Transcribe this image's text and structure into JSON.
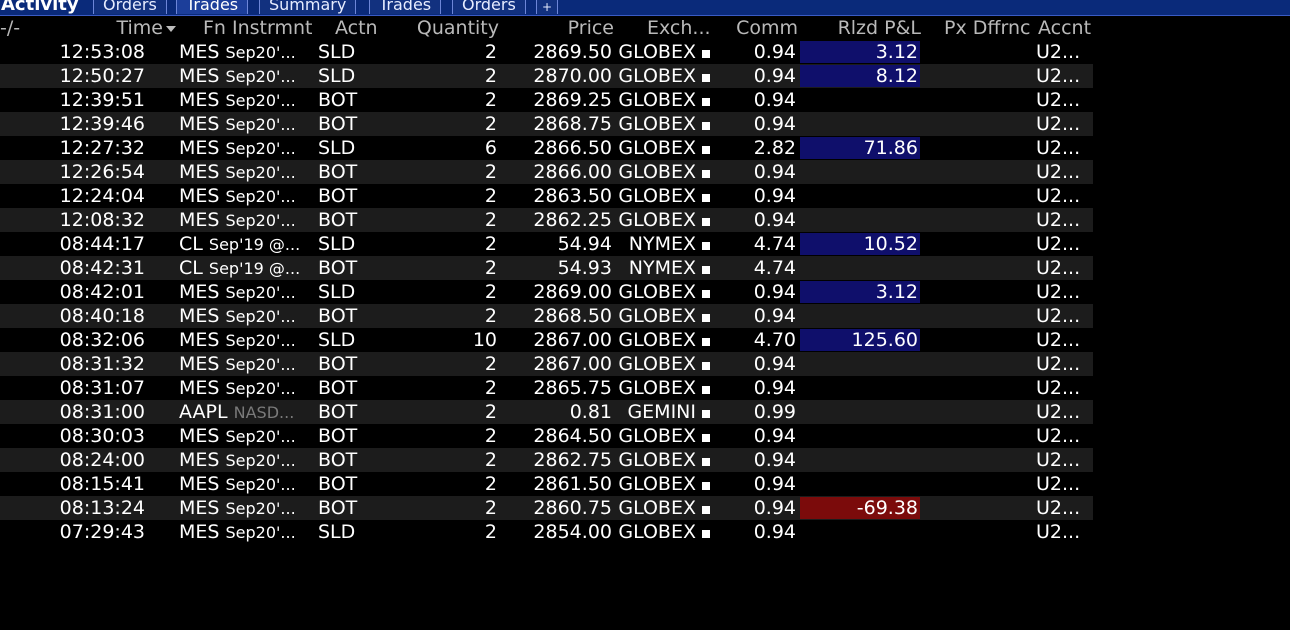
{
  "window": {
    "title": "Activity",
    "tabs": [
      {
        "label": "Orders",
        "active": false
      },
      {
        "label": "Trades",
        "active": true
      },
      {
        "label": "Summary",
        "active": false
      },
      {
        "label": "Trades",
        "active": false
      },
      {
        "label": "Orders",
        "active": false
      }
    ],
    "add_tab": "+"
  },
  "table": {
    "columns": {
      "filter": "-/-",
      "time": "Time",
      "instrument": "Fn Instrmnt",
      "action": "Actn",
      "quantity": "Quantity",
      "price": "Price",
      "exchange": "Exch...",
      "comm": "Comm",
      "pnl": "Rlzd P&L",
      "pxdiff": "Px Dffrnc",
      "account": "Accnt"
    },
    "sort_icon": "sort-descending-icon",
    "colors": {
      "pnl_positive_bg": "#0f0f6b",
      "pnl_negative_bg": "#7b0b0b",
      "row_alt_bg": "#1c1c1c"
    },
    "rows": [
      {
        "time": "12:53:08",
        "sym": "MES",
        "exp": "Sep20'...",
        "action": "SLD",
        "qty": "2",
        "price": "2869.50",
        "exch": "GLOBEX",
        "comm": "0.94",
        "pnl": "3.12",
        "pnl_sign": "pos",
        "acct": "U2..."
      },
      {
        "time": "12:50:27",
        "sym": "MES",
        "exp": "Sep20'...",
        "action": "SLD",
        "qty": "2",
        "price": "2870.00",
        "exch": "GLOBEX",
        "comm": "0.94",
        "pnl": "8.12",
        "pnl_sign": "pos",
        "acct": "U2..."
      },
      {
        "time": "12:39:51",
        "sym": "MES",
        "exp": "Sep20'...",
        "action": "BOT",
        "qty": "2",
        "price": "2869.25",
        "exch": "GLOBEX",
        "comm": "0.94",
        "pnl": "",
        "pnl_sign": "",
        "acct": "U2..."
      },
      {
        "time": "12:39:46",
        "sym": "MES",
        "exp": "Sep20'...",
        "action": "BOT",
        "qty": "2",
        "price": "2868.75",
        "exch": "GLOBEX",
        "comm": "0.94",
        "pnl": "",
        "pnl_sign": "",
        "acct": "U2..."
      },
      {
        "time": "12:27:32",
        "sym": "MES",
        "exp": "Sep20'...",
        "action": "SLD",
        "qty": "6",
        "price": "2866.50",
        "exch": "GLOBEX",
        "comm": "2.82",
        "pnl": "71.86",
        "pnl_sign": "pos",
        "acct": "U2..."
      },
      {
        "time": "12:26:54",
        "sym": "MES",
        "exp": "Sep20'...",
        "action": "BOT",
        "qty": "2",
        "price": "2866.00",
        "exch": "GLOBEX",
        "comm": "0.94",
        "pnl": "",
        "pnl_sign": "",
        "acct": "U2..."
      },
      {
        "time": "12:24:04",
        "sym": "MES",
        "exp": "Sep20'...",
        "action": "BOT",
        "qty": "2",
        "price": "2863.50",
        "exch": "GLOBEX",
        "comm": "0.94",
        "pnl": "",
        "pnl_sign": "",
        "acct": "U2..."
      },
      {
        "time": "12:08:32",
        "sym": "MES",
        "exp": "Sep20'...",
        "action": "BOT",
        "qty": "2",
        "price": "2862.25",
        "exch": "GLOBEX",
        "comm": "0.94",
        "pnl": "",
        "pnl_sign": "",
        "acct": "U2..."
      },
      {
        "time": "08:44:17",
        "sym": "CL",
        "exp": "Sep'19 @...",
        "action": "SLD",
        "qty": "2",
        "price": "54.94",
        "exch": "NYMEX",
        "comm": "4.74",
        "pnl": "10.52",
        "pnl_sign": "pos",
        "acct": "U2..."
      },
      {
        "time": "08:42:31",
        "sym": "CL",
        "exp": "Sep'19 @...",
        "action": "BOT",
        "qty": "2",
        "price": "54.93",
        "exch": "NYMEX",
        "comm": "4.74",
        "pnl": "",
        "pnl_sign": "",
        "acct": "U2..."
      },
      {
        "time": "08:42:01",
        "sym": "MES",
        "exp": "Sep20'...",
        "action": "SLD",
        "qty": "2",
        "price": "2869.00",
        "exch": "GLOBEX",
        "comm": "0.94",
        "pnl": "3.12",
        "pnl_sign": "pos",
        "acct": "U2..."
      },
      {
        "time": "08:40:18",
        "sym": "MES",
        "exp": "Sep20'...",
        "action": "BOT",
        "qty": "2",
        "price": "2868.50",
        "exch": "GLOBEX",
        "comm": "0.94",
        "pnl": "",
        "pnl_sign": "",
        "acct": "U2..."
      },
      {
        "time": "08:32:06",
        "sym": "MES",
        "exp": "Sep20'...",
        "action": "SLD",
        "qty": "10",
        "price": "2867.00",
        "exch": "GLOBEX",
        "comm": "4.70",
        "pnl": "125.60",
        "pnl_sign": "pos",
        "acct": "U2..."
      },
      {
        "time": "08:31:32",
        "sym": "MES",
        "exp": "Sep20'...",
        "action": "BOT",
        "qty": "2",
        "price": "2867.00",
        "exch": "GLOBEX",
        "comm": "0.94",
        "pnl": "",
        "pnl_sign": "",
        "acct": "U2..."
      },
      {
        "time": "08:31:07",
        "sym": "MES",
        "exp": "Sep20'...",
        "action": "BOT",
        "qty": "2",
        "price": "2865.75",
        "exch": "GLOBEX",
        "comm": "0.94",
        "pnl": "",
        "pnl_sign": "",
        "acct": "U2..."
      },
      {
        "time": "08:31:00",
        "sym": "AAPL",
        "exp": "NASD...",
        "exp_dim": true,
        "action": "BOT",
        "qty": "2",
        "price": "0.81",
        "exch": "GEMINI",
        "comm": "0.99",
        "pnl": "",
        "pnl_sign": "",
        "acct": "U2..."
      },
      {
        "time": "08:30:03",
        "sym": "MES",
        "exp": "Sep20'...",
        "action": "BOT",
        "qty": "2",
        "price": "2864.50",
        "exch": "GLOBEX",
        "comm": "0.94",
        "pnl": "",
        "pnl_sign": "",
        "acct": "U2..."
      },
      {
        "time": "08:24:00",
        "sym": "MES",
        "exp": "Sep20'...",
        "action": "BOT",
        "qty": "2",
        "price": "2862.75",
        "exch": "GLOBEX",
        "comm": "0.94",
        "pnl": "",
        "pnl_sign": "",
        "acct": "U2..."
      },
      {
        "time": "08:15:41",
        "sym": "MES",
        "exp": "Sep20'...",
        "action": "BOT",
        "qty": "2",
        "price": "2861.50",
        "exch": "GLOBEX",
        "comm": "0.94",
        "pnl": "",
        "pnl_sign": "",
        "acct": "U2..."
      },
      {
        "time": "08:13:24",
        "sym": "MES",
        "exp": "Sep20'...",
        "action": "BOT",
        "qty": "2",
        "price": "2860.75",
        "exch": "GLOBEX",
        "comm": "0.94",
        "pnl": "-69.38",
        "pnl_sign": "neg",
        "acct": "U2..."
      },
      {
        "time": "07:29:43",
        "sym": "MES",
        "exp": "Sep20'...",
        "action": "SLD",
        "qty": "2",
        "price": "2854.00",
        "exch": "GLOBEX",
        "comm": "0.94",
        "pnl": "",
        "pnl_sign": "",
        "acct": "U2..."
      }
    ]
  }
}
